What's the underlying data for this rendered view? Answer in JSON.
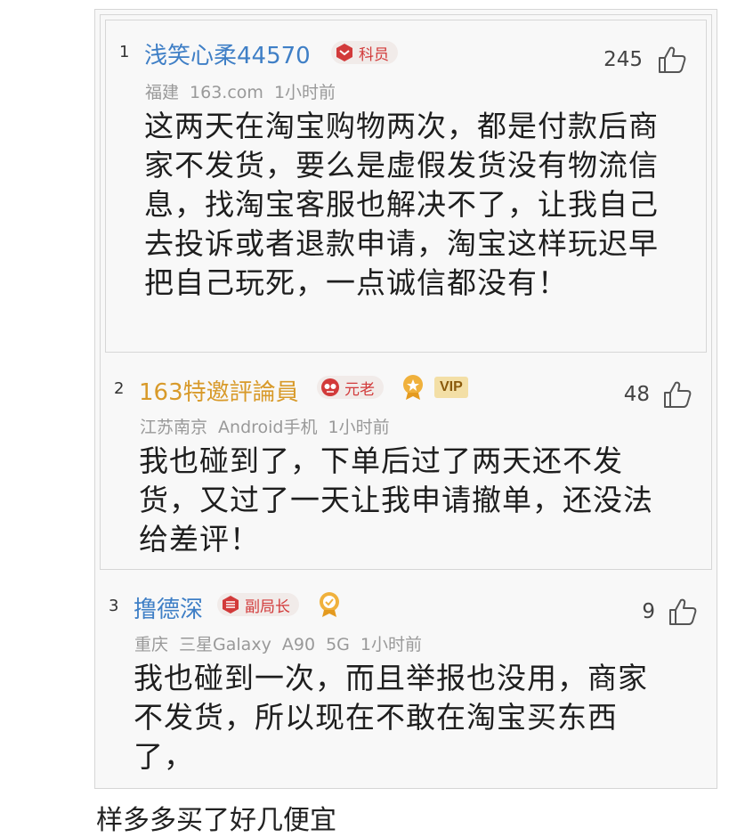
{
  "comments": [
    {
      "index": "1",
      "username": "浅笑心柔44570",
      "badge": "科员",
      "meta": "福建 163.com 1小时前",
      "likes": "245",
      "text": "这两天在淘宝购物两次，都是付款后商家不发货，要么是虚假发货没有物流信息，找淘宝客服也解决不了，让我自己去投诉或者退款申请，淘宝这样玩迟早把自己玩死，一点诚信都没有！"
    },
    {
      "index": "2",
      "username": "163特邀評論員",
      "badge": "元老",
      "vip": "VIP",
      "meta": "江苏南京 Android手机 1小时前",
      "likes": "48",
      "text": "我也碰到了，下单后过了两天还不发货，又过了一天让我申请撤单，还没法给差评！"
    },
    {
      "index": "3",
      "username": "撸德深",
      "badge": "副局长",
      "meta": "重庆 三星Galaxy A90 5G 1小时前",
      "likes": "9",
      "text": "我也碰到一次，而且举报也没用，商家不发货，所以现在不敢在淘宝买东西了，"
    }
  ],
  "footer": {
    "partial_text": "样多多买了好几便宜"
  },
  "colors": {
    "username_blue": "#3f7fc6",
    "username_gold": "#d89a2a",
    "badge_red": "#d23a3a",
    "meta_gray": "#999999"
  },
  "icons": [
    "thumbs-up-icon",
    "rank-badge-icon",
    "medal-icon"
  ]
}
